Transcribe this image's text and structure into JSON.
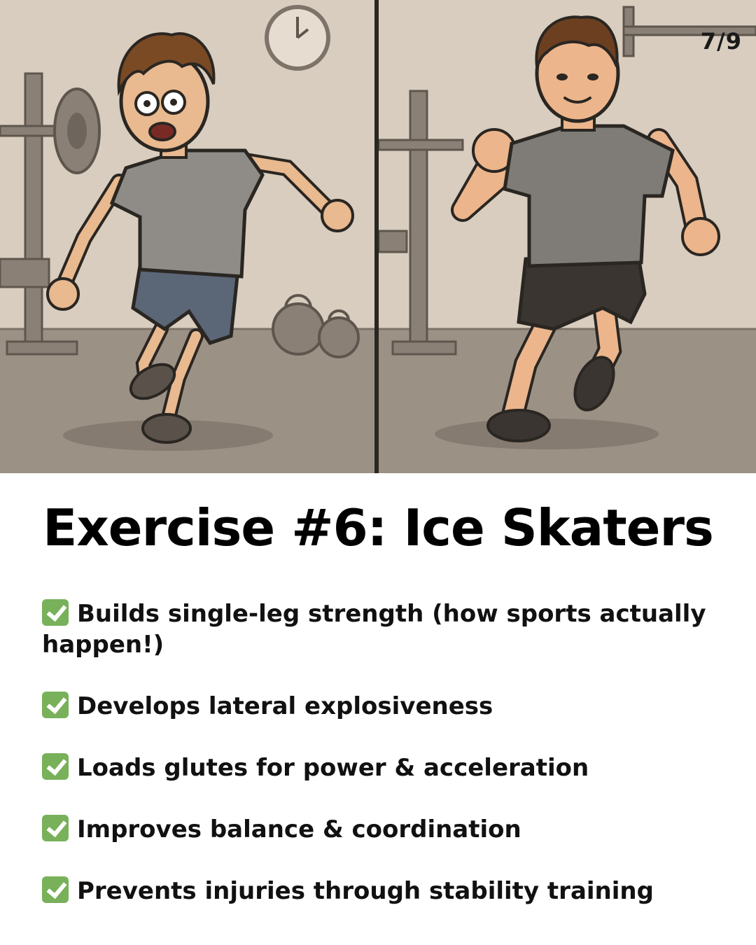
{
  "page_indicator": "7/9",
  "title": "Exercise #6: Ice Skaters",
  "benefits": [
    {
      "icon": "check-mark-icon",
      "text": "Builds single-leg strength (how sports actually happen!)"
    },
    {
      "icon": "check-mark-icon",
      "text": "Develops lateral explosiveness"
    },
    {
      "icon": "check-mark-icon",
      "text": "Loads glutes for power & acceleration"
    },
    {
      "icon": "check-mark-icon",
      "text": "Improves balance & coordination"
    },
    {
      "icon": "check-mark-icon",
      "text": "Prevents injuries through stability training"
    }
  ],
  "colors": {
    "check": "#78b159",
    "wall": "#d8cdbe",
    "floor": "#9c9185",
    "outline": "#2a2622"
  }
}
